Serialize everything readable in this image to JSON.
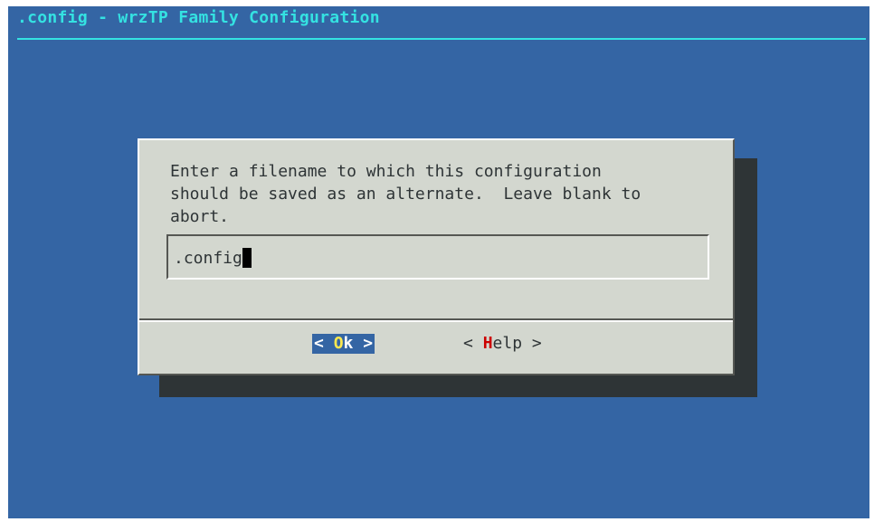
{
  "backtitle": ".config - wrzTP Family Configuration",
  "dialog": {
    "prompt_lines": [
      "Enter a filename to which this configuration",
      "should be saved as an alternate.  Leave blank to",
      "abort."
    ],
    "input_value": ".config"
  },
  "buttons": {
    "ok": {
      "left": "< ",
      "hotkey": "O",
      "rest": "k",
      "right": " >"
    },
    "help": {
      "left": "< ",
      "hotkey": "H",
      "rest": "elp",
      "right": " >"
    }
  },
  "colors": {
    "background": "#3465a4",
    "title": "#34e2e2",
    "dialog": "#d3d7cf",
    "shadow": "#2e3436",
    "ok_hotkey": "#fce94f",
    "help_hotkey": "#cc0000"
  }
}
